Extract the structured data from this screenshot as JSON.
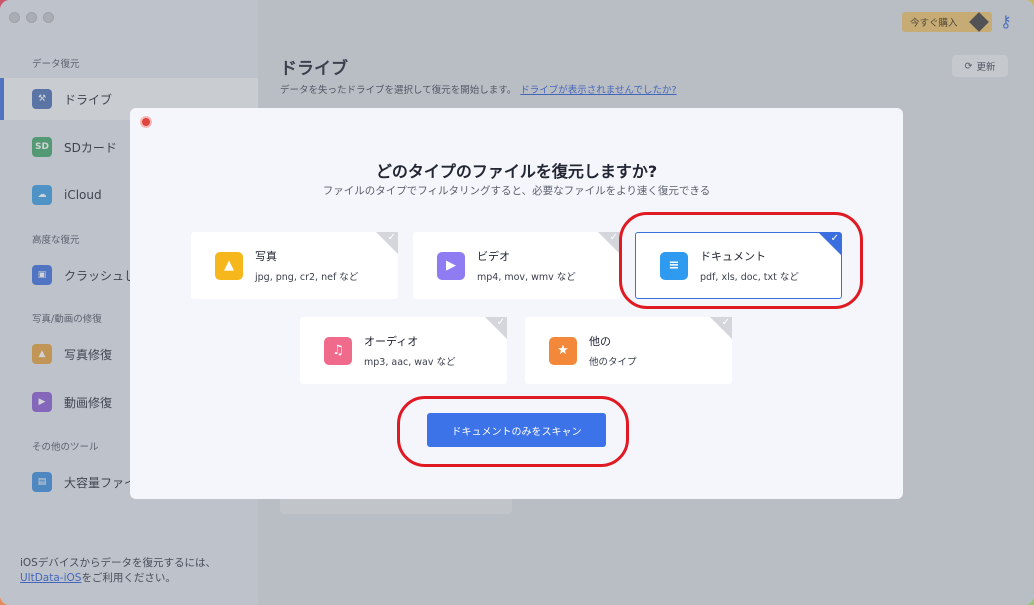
{
  "sidebar": {
    "sections": {
      "data_recovery": "データ復元",
      "advanced_recovery": "高度な復元",
      "photo_video_repair": "写真/動画の修復",
      "other_tools": "その他のツール"
    },
    "items": [
      {
        "label": "ドライブ",
        "icon": "drive-icon"
      },
      {
        "label": "SDカード",
        "icon": "sd-card-icon"
      },
      {
        "label": "iCloud",
        "icon": "icloud-icon"
      },
      {
        "label": "クラッシュし",
        "icon": "crash-computer-icon"
      },
      {
        "label": "写真修復",
        "icon": "photo-repair-icon"
      },
      {
        "label": "動画修復",
        "icon": "video-repair-icon"
      },
      {
        "label": "大容量ファイ",
        "icon": "large-file-icon"
      }
    ],
    "footer": {
      "line1": "iOSデバイスからデータを復元するには、",
      "link": "UltData-iOS",
      "line2": "をご利用ください。"
    }
  },
  "header": {
    "buy_label": "今すぐ購入",
    "refresh_label": "更新"
  },
  "main": {
    "title": "ドライブ",
    "subtitle": "データを失ったドライブを選択して復元を開始します。",
    "help_link": "ドライブが表示されませんでしたか?"
  },
  "modal": {
    "title": "どのタイプのファイルを復元しますか?",
    "subtitle": "ファイルのタイプでフィルタリングすると、必要なファイルをより速く復元できる",
    "types": [
      {
        "name": "写真",
        "desc": "jpg, png, cr2, nef など",
        "icon": "image-icon",
        "color": "#f6b71c",
        "selected": false
      },
      {
        "name": "ビデオ",
        "desc": "mp4, mov, wmv など",
        "icon": "video-icon",
        "color": "#8f7cf2",
        "selected": false
      },
      {
        "name": "ドキュメント",
        "desc": "pdf, xls, doc, txt など",
        "icon": "document-icon",
        "color": "#2f9bf0",
        "selected": true
      },
      {
        "name": "オーディオ",
        "desc": "mp3, aac, wav など",
        "icon": "audio-icon",
        "color": "#f06a8c",
        "selected": false
      },
      {
        "name": "他の",
        "desc": "他のタイプ",
        "icon": "star-icon",
        "color": "#f4883a",
        "selected": false
      }
    ],
    "scan_button": "ドキュメントのみをスキャン"
  },
  "colors": {
    "accent": "#3d73e8",
    "annotation": "#e01a22"
  }
}
